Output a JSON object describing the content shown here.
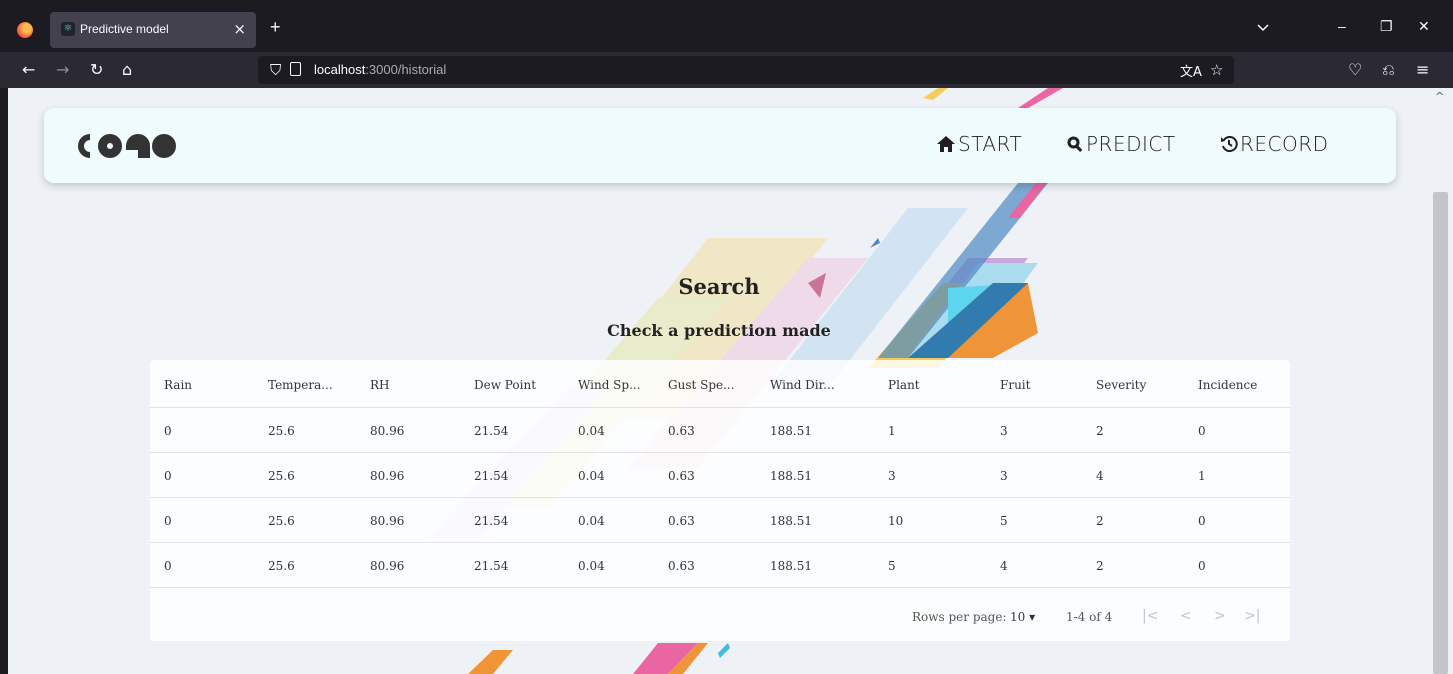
{
  "browser": {
    "tab_title": "Predictive model",
    "tab_close": "×",
    "new_tab": "+",
    "url_host": "localhost",
    "url_path": ":3000/historial"
  },
  "nav": {
    "start": "START",
    "predict": "PREDICT",
    "record": "RECORD"
  },
  "search": {
    "title": "Search",
    "subtitle": "Check a prediction made"
  },
  "table": {
    "columns": [
      "Rain",
      "Tempera...",
      "RH",
      "Dew Point",
      "Wind Sp...",
      "Gust Spe...",
      "Wind Dir...",
      "Plant",
      "Fruit",
      "Severity",
      "Incidence"
    ],
    "rows": [
      [
        "0",
        "25.6",
        "80.96",
        "21.54",
        "0.04",
        "0.63",
        "188.51",
        "1",
        "3",
        "2",
        "0"
      ],
      [
        "0",
        "25.6",
        "80.96",
        "21.54",
        "0.04",
        "0.63",
        "188.51",
        "3",
        "3",
        "4",
        "1"
      ],
      [
        "0",
        "25.6",
        "80.96",
        "21.54",
        "0.04",
        "0.63",
        "188.51",
        "10",
        "5",
        "2",
        "0"
      ],
      [
        "0",
        "25.6",
        "80.96",
        "21.54",
        "0.04",
        "0.63",
        "188.51",
        "5",
        "4",
        "2",
        "0"
      ]
    ]
  },
  "pagination": {
    "rows_per_page_label": "Rows per page:",
    "rows_per_page_value": "10",
    "range": "1-4 of 4"
  },
  "colors": {
    "header_bg": "#effbfd",
    "page_bg": "#eef2f6",
    "chrome_dark": "#1c1b22",
    "chrome_toolbar": "#2b2a33"
  }
}
